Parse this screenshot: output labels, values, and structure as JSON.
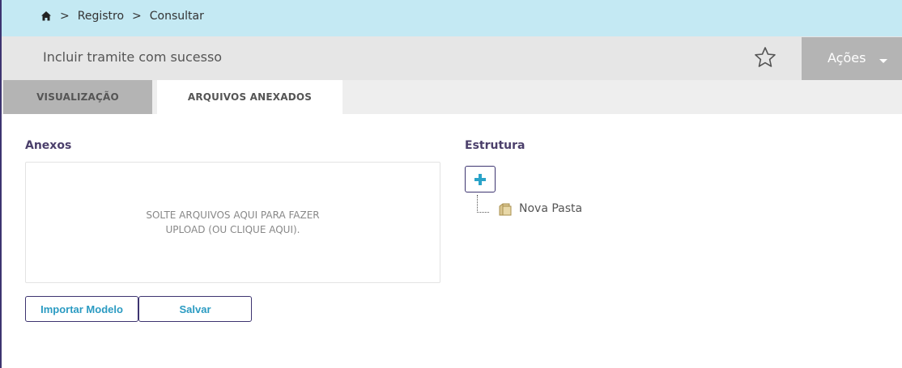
{
  "breadcrumb": {
    "home_icon": "home-icon",
    "separator": ">",
    "items": [
      "Registro",
      "Consultar"
    ]
  },
  "header": {
    "title": "Incluir tramite com sucesso",
    "favorite_icon": "star-icon",
    "actions_label": "Ações",
    "actions_icon": "caret-down-icon"
  },
  "tabs": [
    {
      "label": "VISUALIZAÇÃO",
      "active": false
    },
    {
      "label": "ARQUIVOS ANEXADOS",
      "active": true
    }
  ],
  "anexos": {
    "label": "Anexos",
    "dropzone_line1": "SOLTE ARQUIVOS AQUI PARA FAZER",
    "dropzone_line2": "UPLOAD (OU CLIQUE AQUI).",
    "import_button": "Importar Modelo",
    "save_button": "Salvar"
  },
  "estrutura": {
    "label": "Estrutura",
    "add_icon": "plus-icon",
    "tree": [
      {
        "label": "Nova Pasta",
        "icon": "folder-icon"
      }
    ]
  },
  "colors": {
    "breadcrumb_bg": "#c4e9f3",
    "title_bar_bg": "#e6e6e6",
    "actions_bg": "#b4b4b4",
    "accent": "#2aa3c8",
    "border_accent": "#3d3470",
    "section_label": "#4b3f6b"
  }
}
